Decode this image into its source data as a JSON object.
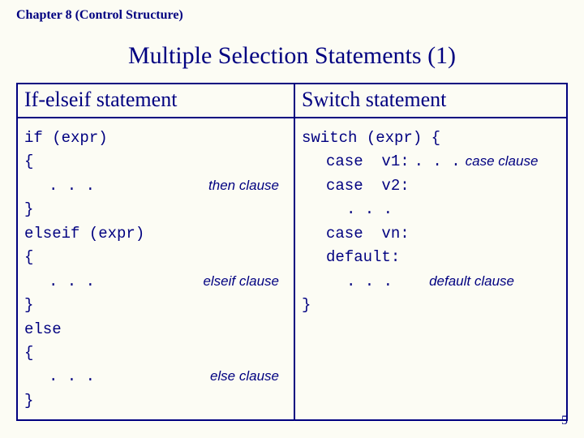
{
  "chapter": "Chapter 8 (Control Structure)",
  "title": "Multiple Selection Statements (1)",
  "col_left_head": "If-elseif  statement",
  "col_right_head": "Switch statement",
  "left": {
    "l1": "if (expr)",
    "l2": "{",
    "l3": ". . .",
    "l3_annot": "then clause",
    "l4": "}",
    "l5": "elseif (expr)",
    "l6": "{",
    "l7": ". . .",
    "l7_annot": "elseif clause",
    "l8": "}",
    "l9": "else",
    "l10": "{",
    "l11": ". . .",
    "l11_annot": "else clause",
    "l12": "}"
  },
  "right": {
    "r1": "switch (expr) {",
    "r2a": "case  v1:",
    "r2b": ". . .",
    "r2_annot": "case  clause",
    "r3": "case  v2:",
    "r4": ". . .",
    "r5": "case  vn:",
    "r6": "default:",
    "r7": ". . .",
    "r7_annot": "default clause",
    "r8": "}"
  },
  "page_number": "5"
}
